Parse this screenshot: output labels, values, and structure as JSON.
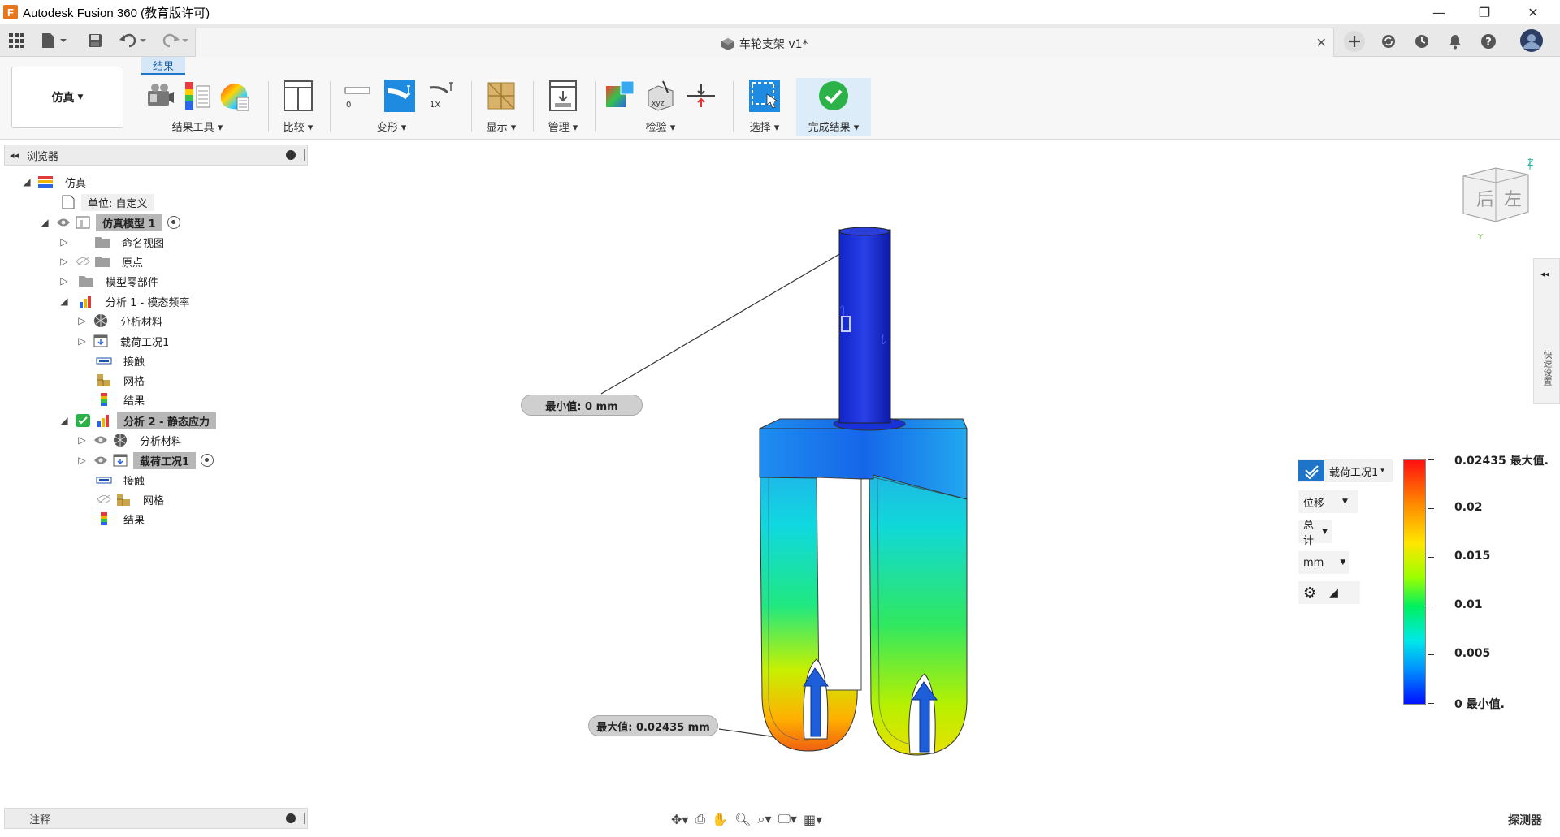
{
  "window": {
    "title": "Autodesk Fusion 360 (教育版许可)",
    "minimize": "—",
    "restore": "❐",
    "close": "✕"
  },
  "tab": {
    "document_title": "车轮支架 v1*",
    "close": "✕"
  },
  "toolbar": {
    "workspace": "仿真",
    "ribbon_tab": "结果",
    "groups": {
      "result_tools": "结果工具",
      "compare": "比较",
      "deform": "变形",
      "display": "显示",
      "manage": "管理",
      "inspect": "检验",
      "select": "选择",
      "finish": "完成结果"
    },
    "deform_field": "0",
    "deform_scale": "1X"
  },
  "browser": {
    "header": "浏览器",
    "root": "仿真",
    "units": "单位: 自定义",
    "model": "仿真模型 1",
    "named_views": "命名视图",
    "origin": "原点",
    "model_components": "模型零部件",
    "analysis1": "分析 1 - 模态频率",
    "analysis1_children": {
      "materials": "分析材料",
      "load_case": "载荷工况1",
      "contacts": "接触",
      "mesh": "网格",
      "results": "结果"
    },
    "analysis2": "分析 2 - 静态应力",
    "analysis2_children": {
      "materials": "分析材料",
      "load_case": "载荷工况1",
      "contacts": "接触",
      "mesh": "网格",
      "results": "结果"
    }
  },
  "notes": {
    "header": "注释"
  },
  "viewport": {
    "min_callout": "最小值: 0 mm",
    "max_callout": "最大值: 0.02435 mm",
    "viewcube_back": "后",
    "viewcube_left": "左",
    "axis_z": "Z",
    "axis_y": "Y",
    "side_panel": "快速设置"
  },
  "legend": {
    "load_case": "载荷工况1",
    "result_type": "位移",
    "component": "总计",
    "unit": "mm",
    "ticks": [
      "0.02435 最大值.",
      "0.02",
      "0.015",
      "0.01",
      "0.005",
      "0 最小值."
    ],
    "max": 0.02435,
    "min": 0
  },
  "bottom": {
    "inspector": "探测器"
  },
  "colors": {
    "accent_blue": "#1e74c8",
    "finish_green": "#2db24a",
    "mesh_max": "#ff1010",
    "mesh_min": "#0010ff"
  }
}
